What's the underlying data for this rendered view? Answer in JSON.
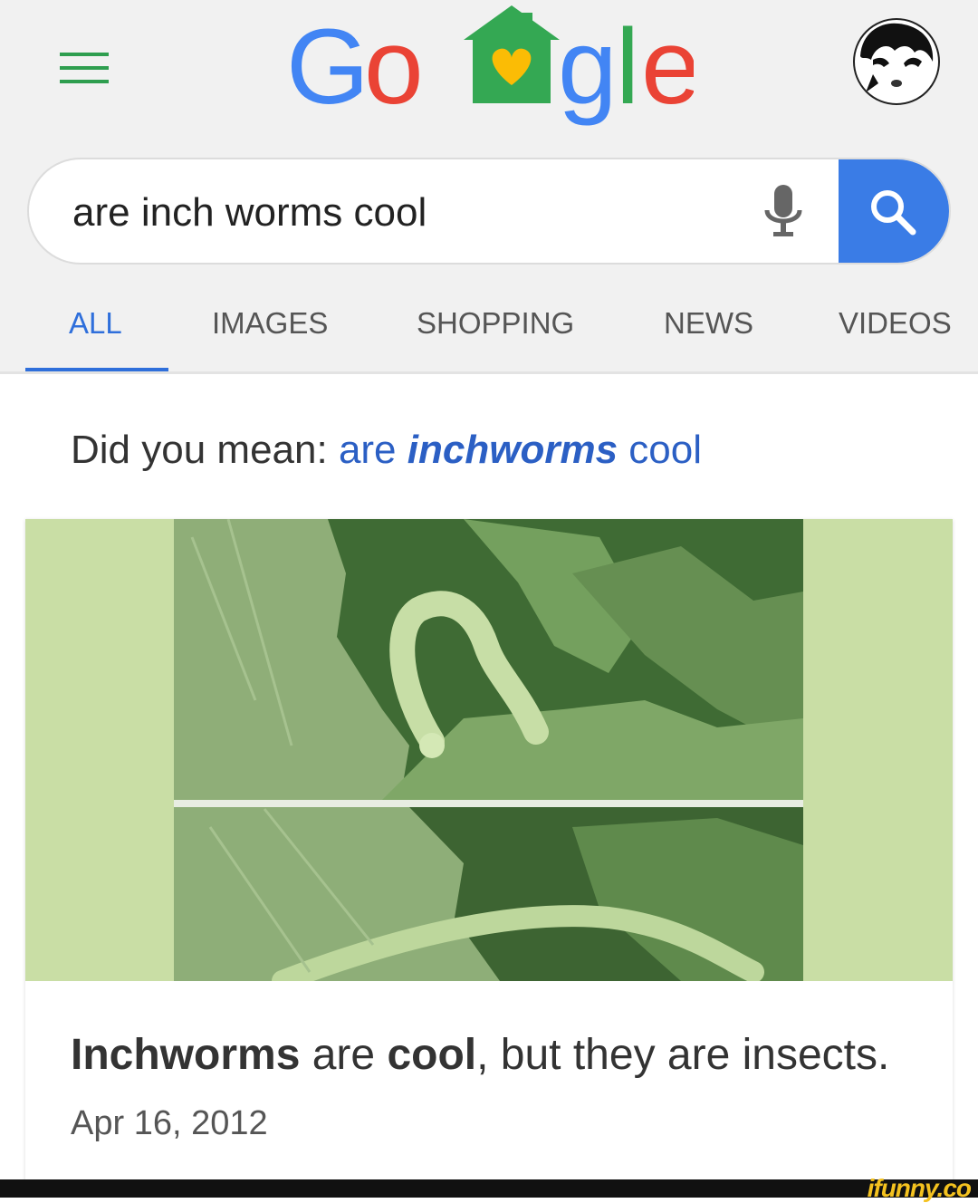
{
  "header": {
    "logo_text": "Google",
    "logo_colors": {
      "blue": "#4285F4",
      "red": "#EA4335",
      "green": "#34A853",
      "yellow": "#FBBC05"
    },
    "menu_icon": "hamburger-menu-icon",
    "avatar_icon": "user-avatar-icon"
  },
  "search": {
    "query": "are inch worms cool",
    "mic_icon": "microphone-icon",
    "search_icon": "magnifier-icon",
    "accent_color": "#3a7ce6"
  },
  "tabs": [
    {
      "label": "ALL",
      "active": true
    },
    {
      "label": "IMAGES",
      "active": false
    },
    {
      "label": "SHOPPING",
      "active": false
    },
    {
      "label": "NEWS",
      "active": false
    },
    {
      "label": "VIDEOS",
      "active": false
    }
  ],
  "suggestion": {
    "prefix": "Did you mean:",
    "link_before": "are ",
    "link_bold": "inchworms",
    "link_after": " cool"
  },
  "result": {
    "bold_1": "Inchworms",
    "text_1": " are ",
    "bold_2": "cool",
    "text_2": ", but they are insects.",
    "date": "Apr 16, 2012"
  },
  "watermark": "ifunny.co"
}
